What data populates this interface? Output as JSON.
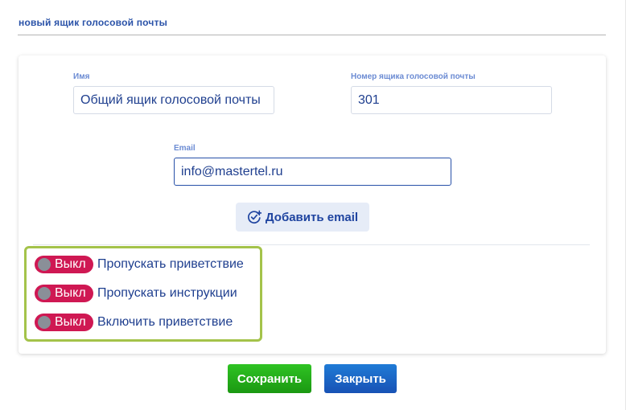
{
  "dialog": {
    "title": "новый ящик голосовой почты"
  },
  "form": {
    "name_label": "Имя",
    "name_value": "Общий ящик голосовой почты",
    "number_label": "Номер ящика голосовой почты",
    "number_value": "301",
    "email_label": "Email",
    "email_value": "info@mastertel.ru",
    "add_email_label": "Добавить email",
    "add_email_icon": "add-circle-check-icon"
  },
  "toggles": [
    {
      "state_label": "Выкл",
      "label": "Пропускать приветствие",
      "on": false
    },
    {
      "state_label": "Выкл",
      "label": "Пропускать инструкции",
      "on": false
    },
    {
      "state_label": "Выкл",
      "label": "Включить приветствие",
      "on": false
    }
  ],
  "actions": {
    "save_label": "Сохранить",
    "close_label": "Закрыть"
  },
  "colors": {
    "accent_blue": "#1f3f8f",
    "toggle_off": "#cf1853",
    "highlight_border": "#a4c34a",
    "save_green": "#2fc323",
    "close_blue": "#1f7bd6"
  }
}
